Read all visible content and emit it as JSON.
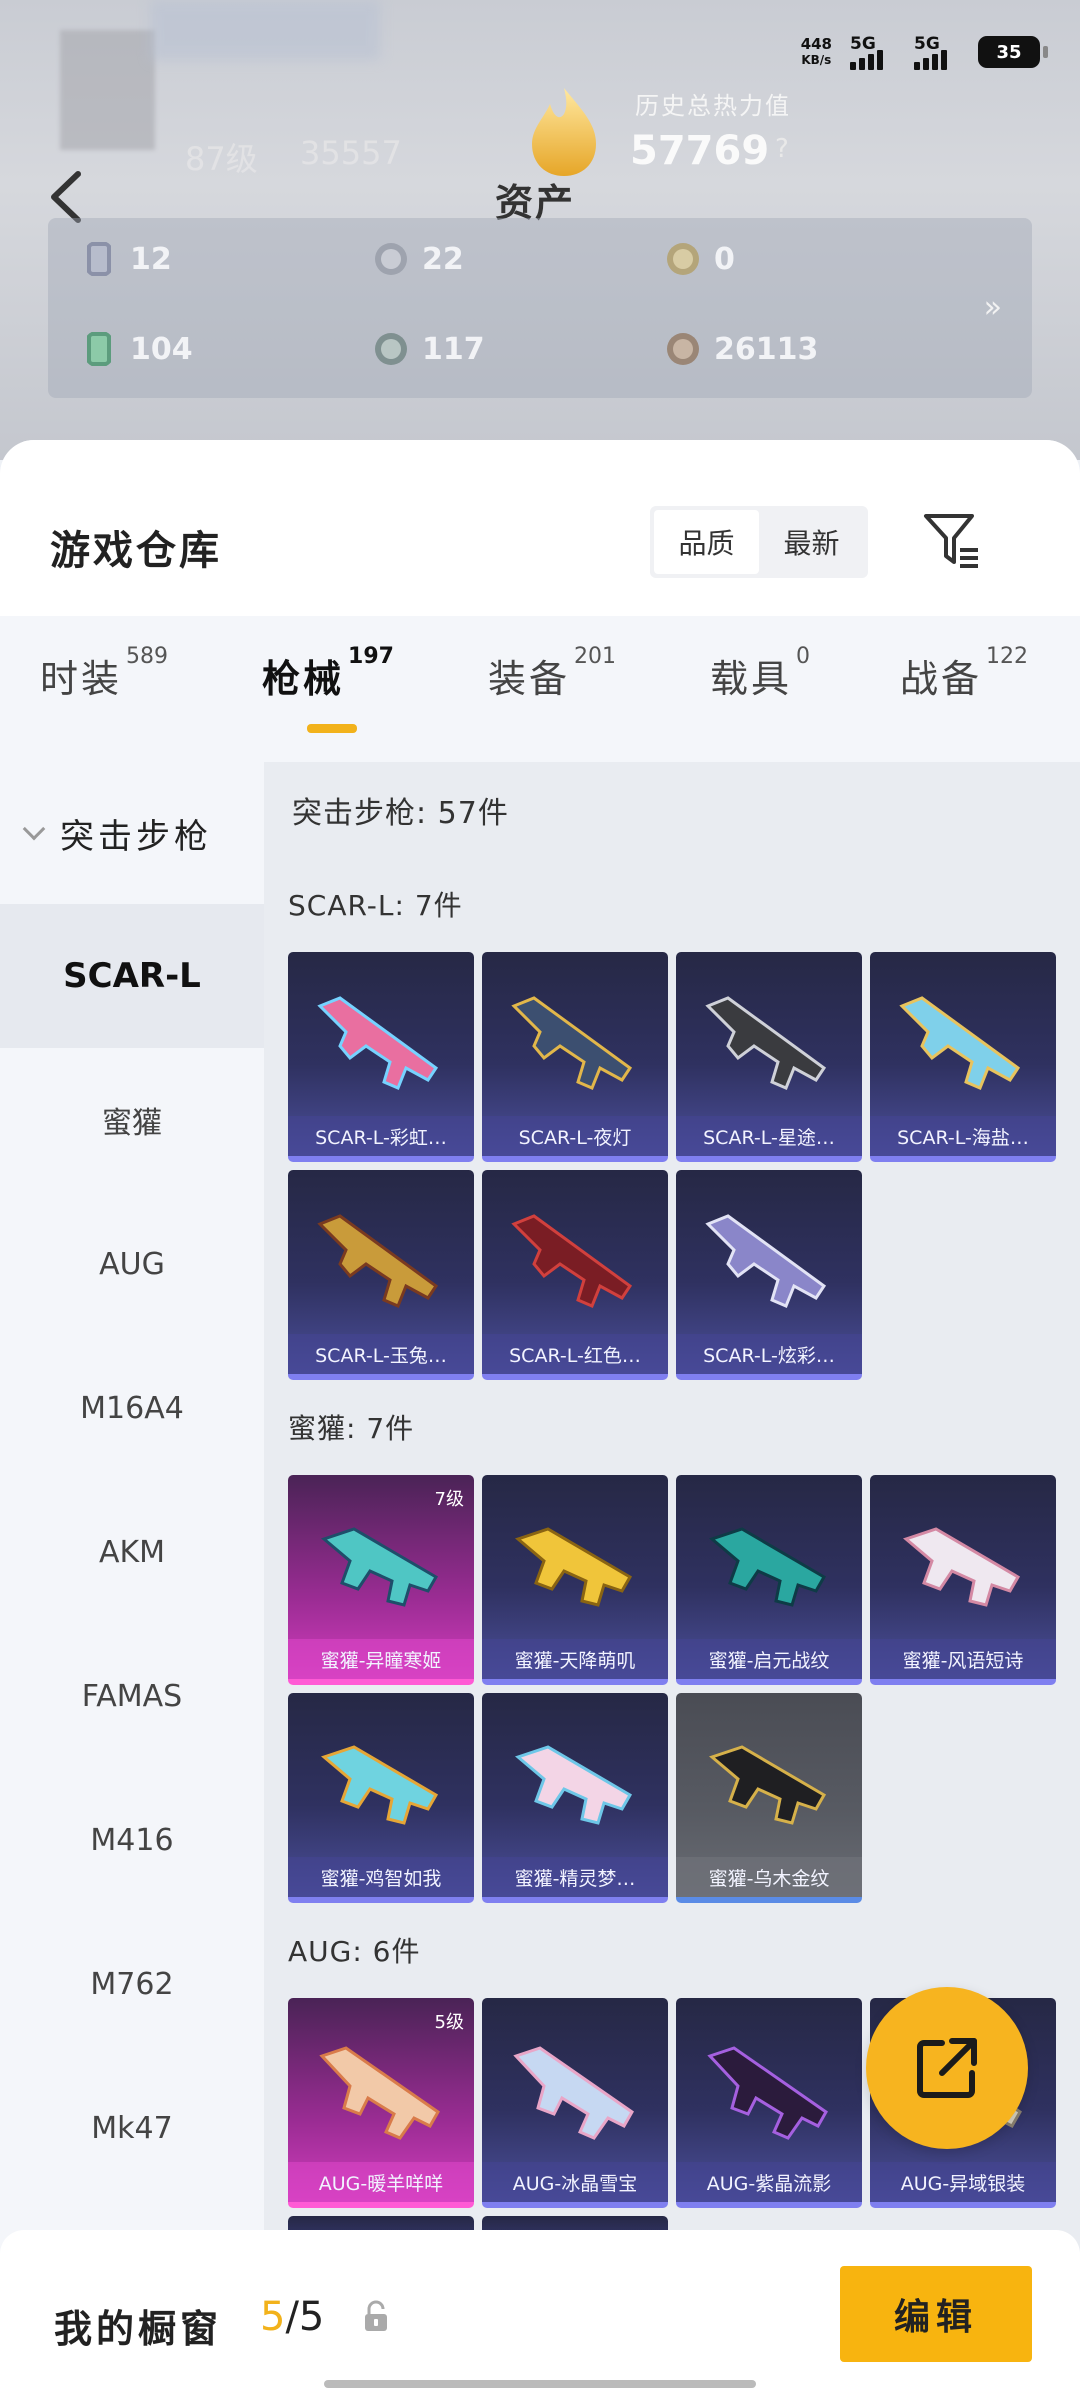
{
  "status_bar": {
    "net_speed_value": "448",
    "net_speed_unit": "KB/s",
    "signal1": "5G",
    "signal2": "5G",
    "battery": "35"
  },
  "header": {
    "title": "资产",
    "heat_label": "历史总热力值",
    "heat_value": "57769",
    "heat_help": "?",
    "faded_left": "87级",
    "faded_right": "35557"
  },
  "assets": {
    "items": [
      {
        "value": "12",
        "icon": "card-icon"
      },
      {
        "value": "22",
        "icon": "silver-coin-icon"
      },
      {
        "value": "0",
        "icon": "gold-coin-icon"
      },
      {
        "value": "104",
        "icon": "green-ticket-icon"
      },
      {
        "value": "117",
        "icon": "platinum-coin-icon"
      },
      {
        "value": "26113",
        "icon": "bronze-coin-icon"
      }
    ],
    "more": "»"
  },
  "warehouse": {
    "title": "游戏仓库",
    "sort": {
      "options": [
        "品质",
        "最新"
      ],
      "selected": "品质"
    }
  },
  "tabs": [
    {
      "label": "时装",
      "count": "589"
    },
    {
      "label": "枪械",
      "count": "197",
      "active": true
    },
    {
      "label": "装备",
      "count": "201"
    },
    {
      "label": "载具",
      "count": "0"
    },
    {
      "label": "战备",
      "count": "122"
    }
  ],
  "sidebar": {
    "category": "突击步枪",
    "items": [
      "SCAR-L",
      "蜜獾",
      "AUG",
      "M16A4",
      "AKM",
      "FAMAS",
      "M416",
      "M762",
      "Mk47"
    ],
    "selected": "SCAR-L"
  },
  "content": {
    "heading": "突击步枪: 57件",
    "sections": [
      {
        "title": "SCAR-L: 7件",
        "cards": [
          "SCAR-L-彩虹…",
          "SCAR-L-夜灯",
          "SCAR-L-星途…",
          "SCAR-L-海盐…",
          "SCAR-L-玉兔…",
          "SCAR-L-红色…",
          "SCAR-L-炫彩…"
        ]
      },
      {
        "title": "蜜獾: 7件",
        "cards": [
          "蜜獾-异瞳寒姬",
          "蜜獾-天降萌叽",
          "蜜獾-启元战纹",
          "蜜獾-风语短诗",
          "蜜獾-鸡智如我",
          "蜜獾-精灵梦…",
          "蜜獾-乌木金纹"
        ],
        "level_badge": "7级"
      },
      {
        "title": "AUG: 6件",
        "cards": [
          "AUG-暖羊咩咩",
          "AUG-冰晶雪宝",
          "AUG-紫晶流影",
          "AUG-异域银装"
        ],
        "level_badge": "5级"
      }
    ]
  },
  "showcase": {
    "label": "我的橱窗",
    "current": "5",
    "total": "/5",
    "edit_label": "编辑"
  },
  "colors": {
    "accent": "#f7b41f",
    "purple_border": "#7f7ff0",
    "pink_border": "#ff5ad5"
  }
}
